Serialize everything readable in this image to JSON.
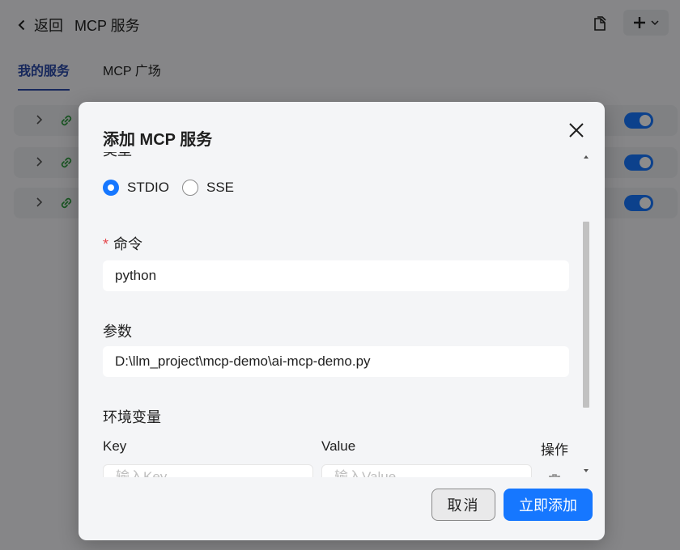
{
  "header": {
    "back_label": "返回",
    "title": "MCP 服务"
  },
  "tabs": [
    {
      "label": "我的服务",
      "active": true
    },
    {
      "label": "MCP 广场",
      "active": false
    }
  ],
  "services": [
    {
      "enabled": true
    },
    {
      "enabled": true
    },
    {
      "enabled": true
    }
  ],
  "dialog": {
    "title": "添加 MCP 服务",
    "type_label": "类型",
    "type_options": [
      {
        "label": "STDIO",
        "checked": true
      },
      {
        "label": "SSE",
        "checked": false
      }
    ],
    "command_label": "命令",
    "command_required_mark": "*",
    "command_value": "python",
    "args_label": "参数",
    "args_value": "D:\\llm_project\\mcp-demo\\ai-mcp-demo.py",
    "env_label": "环境变量",
    "env_columns": {
      "key": "Key",
      "value": "Value",
      "action": "操作"
    },
    "env_key_placeholder": "输入Key",
    "env_value_placeholder": "输入Value",
    "cancel_label": "取消",
    "confirm_label": "立即添加"
  },
  "colors": {
    "accent": "#1677ff",
    "tab_active": "#2b4aa8",
    "required": "#e5484d"
  }
}
